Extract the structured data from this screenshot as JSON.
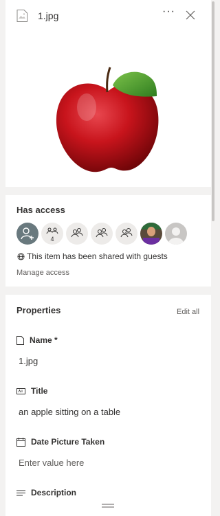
{
  "file": {
    "name": "1.jpg"
  },
  "header": {
    "more_label": "···"
  },
  "access": {
    "title": "Has access",
    "group_count": "4",
    "guest_note": "This item has been shared with guests",
    "manage_label": "Manage access"
  },
  "properties": {
    "title": "Properties",
    "edit_all_label": "Edit all",
    "fields": [
      {
        "label": "Name *",
        "value": "1.jpg"
      },
      {
        "label": "Title",
        "value": "an apple sitting on a table"
      },
      {
        "label": "Date Picture Taken",
        "placeholder": "Enter value here"
      },
      {
        "label": "Description"
      }
    ]
  },
  "colors": {
    "accent": "#0078d4",
    "avatar_primary": "#69797e",
    "avatar_light": "#edebe9",
    "band": "#f3f2f1"
  }
}
